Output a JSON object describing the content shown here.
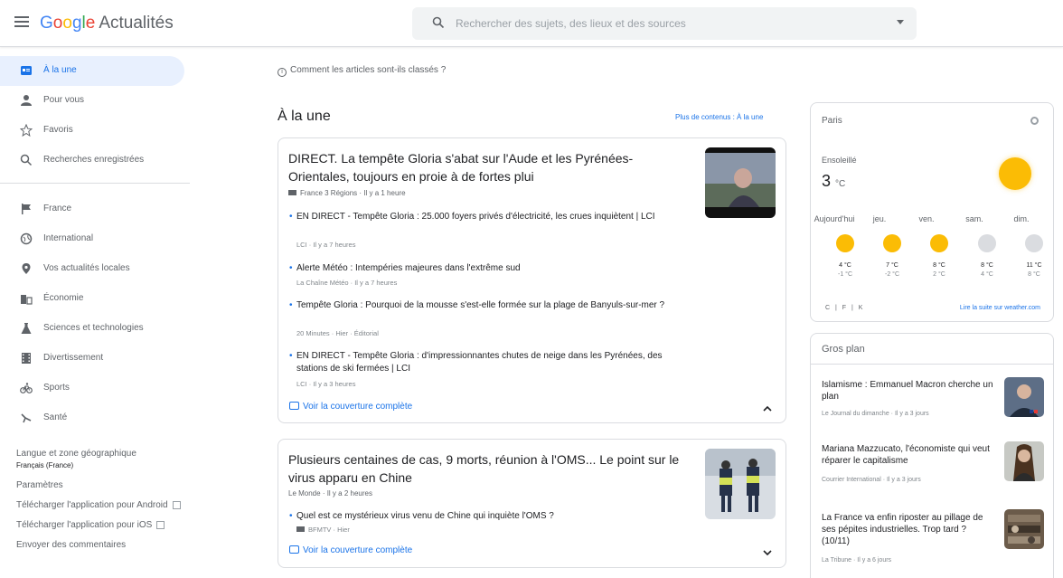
{
  "header": {
    "logo_letters": [
      "G",
      "o",
      "o",
      "g",
      "l",
      "e"
    ],
    "app_name": "Actualités",
    "search_placeholder": "Rechercher des sujets, des lieux et des sources"
  },
  "sidebar": {
    "items": [
      {
        "label": "À la une",
        "icon": "home-icon",
        "active": true
      },
      {
        "label": "Pour vous",
        "icon": "person-icon"
      },
      {
        "label": "Favoris",
        "icon": "star-icon"
      },
      {
        "label": "Recherches enregistrées",
        "icon": "search-icon"
      },
      {
        "label": "France",
        "icon": "flag-icon"
      },
      {
        "label": "International",
        "icon": "globe-icon"
      },
      {
        "label": "Vos actualités locales",
        "icon": "location-pin-icon"
      },
      {
        "label": "Économie",
        "icon": "building-icon"
      },
      {
        "label": "Sciences et technologies",
        "icon": "flask-icon"
      },
      {
        "label": "Divertissement",
        "icon": "film-icon"
      },
      {
        "label": "Sports",
        "icon": "bike-icon"
      },
      {
        "label": "Santé",
        "icon": "health-icon"
      }
    ],
    "language_label": "Langue et zone géographique",
    "language_value": "Français (France)",
    "settings": "Paramètres",
    "android": "Télécharger l'application pour Android",
    "ios": "Télécharger l'application pour iOS",
    "feedback": "Envoyer des commentaires"
  },
  "main": {
    "how_ranked": "Comment les articles sont-ils classés ?",
    "section_title": "À la une",
    "more_link": "Plus de contenus : À la une",
    "full_coverage": "Voir la couverture complète",
    "card1": {
      "headline": "DIRECT. La tempête Gloria s'abat sur l'Aude et les Pyrénées-Orientales, toujours en proie à de fortes plui",
      "source": "France 3 Régions",
      "time": "Il y a 1 heure",
      "subs": [
        {
          "title": "EN DIRECT - Tempête Gloria : 25.000 foyers privés d'électricité, les crues inquiètent | LCI",
          "meta": "LCI · Il y a 7 heures"
        },
        {
          "title": "Alerte Météo : Intempéries majeures dans l'extrême sud",
          "meta": "La Chaîne Météo · Il y a 7 heures"
        },
        {
          "title": "Tempête Gloria : Pourquoi de la mousse s'est-elle formée sur la plage de Banyuls-sur-mer ?",
          "meta": "20 Minutes · Hier · Éditorial"
        },
        {
          "title": "EN DIRECT - Tempête Gloria : d'impressionnantes chutes de neige dans les Pyrénées, des stations de ski fermées | LCI",
          "meta": "LCI · Il y a 3 heures"
        }
      ]
    },
    "card2": {
      "headline": "Plusieurs centaines de cas, 9 morts, réunion à l'OMS... Le point sur le virus apparu en Chine",
      "source": "Le Monde",
      "time": "Il y a 2 heures",
      "subs": [
        {
          "title": "Quel est ce mystérieux virus venu de Chine qui inquiète l'OMS ?",
          "meta": "BFMTV · Hier"
        }
      ]
    }
  },
  "weather": {
    "city": "Paris",
    "condition": "Ensoleillé",
    "temp": "3",
    "unit": "°C",
    "days": [
      {
        "day": "Aujourd'hui",
        "hi": "4 °C",
        "lo": "-1 °C",
        "icon": "sun-icon"
      },
      {
        "day": "jeu.",
        "hi": "7 °C",
        "lo": "-2 °C",
        "icon": "sun-cloud-icon"
      },
      {
        "day": "ven.",
        "hi": "8 °C",
        "lo": "2 °C",
        "icon": "sun-cloud-icon"
      },
      {
        "day": "sam.",
        "hi": "8 °C",
        "lo": "4 °C",
        "icon": "cloud-icon"
      },
      {
        "day": "dim.",
        "hi": "11 °C",
        "lo": "8 °C",
        "icon": "rain-icon"
      }
    ],
    "units": "C | F | K",
    "more": "Lire la suite sur weather.com"
  },
  "closeup": {
    "title": "Gros plan",
    "items": [
      {
        "title": "Islamisme : Emmanuel Macron cherche un plan",
        "meta": "Le Journal du dimanche · Il y a 3 jours"
      },
      {
        "title": "Mariana Mazzucato, l'économiste qui veut réparer le capitalisme",
        "meta": "Courrier International · Il y a 3 jours"
      },
      {
        "title": "La France va enfin riposter au pillage de ses pépites industrielles. Trop tard ? (10/11)",
        "meta": "La Tribune · Il y a 6 jours"
      }
    ]
  },
  "colors": {
    "accent": "#1a73e8",
    "active_bg": "#e8f0fe",
    "sun": "#fbbc05"
  }
}
